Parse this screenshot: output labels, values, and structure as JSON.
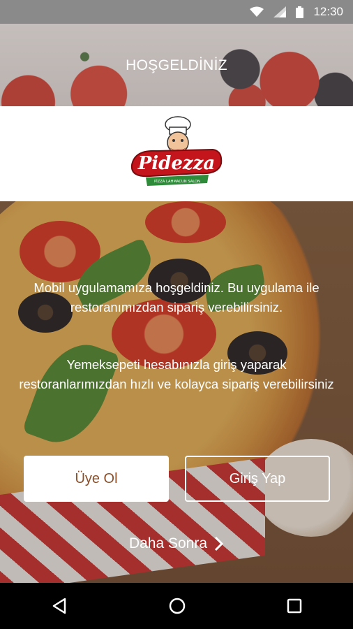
{
  "status_bar": {
    "time": "12:30",
    "icons": [
      "wifi-icon",
      "signal-icon",
      "battery-icon"
    ]
  },
  "header": {
    "title": "HOŞGELDİNİZ"
  },
  "logo": {
    "brand": "Pidezza",
    "tagline": "PİZZA LAHMACUN SALON"
  },
  "hero": {
    "welcome_text": "Mobil uygulamamıza hoşgeldiniz. Bu uygulama ile restoranımızdan sipariş verebilirsiniz.",
    "info_text": "Yemeksepeti hesabınızla giriş yaparak restoranlarımızdan hızlı ve kolayca sipariş verebilirsiniz"
  },
  "buttons": {
    "register_label": "Üye Ol",
    "login_label": "Giriş Yap",
    "later_label": "Daha Sonra"
  },
  "nav": {
    "icons": [
      "back-icon",
      "home-icon",
      "recents-icon"
    ]
  },
  "colors": {
    "register_text": "#8b4f2a",
    "logo_red": "#c4151c",
    "logo_green": "#2e8b3a"
  }
}
